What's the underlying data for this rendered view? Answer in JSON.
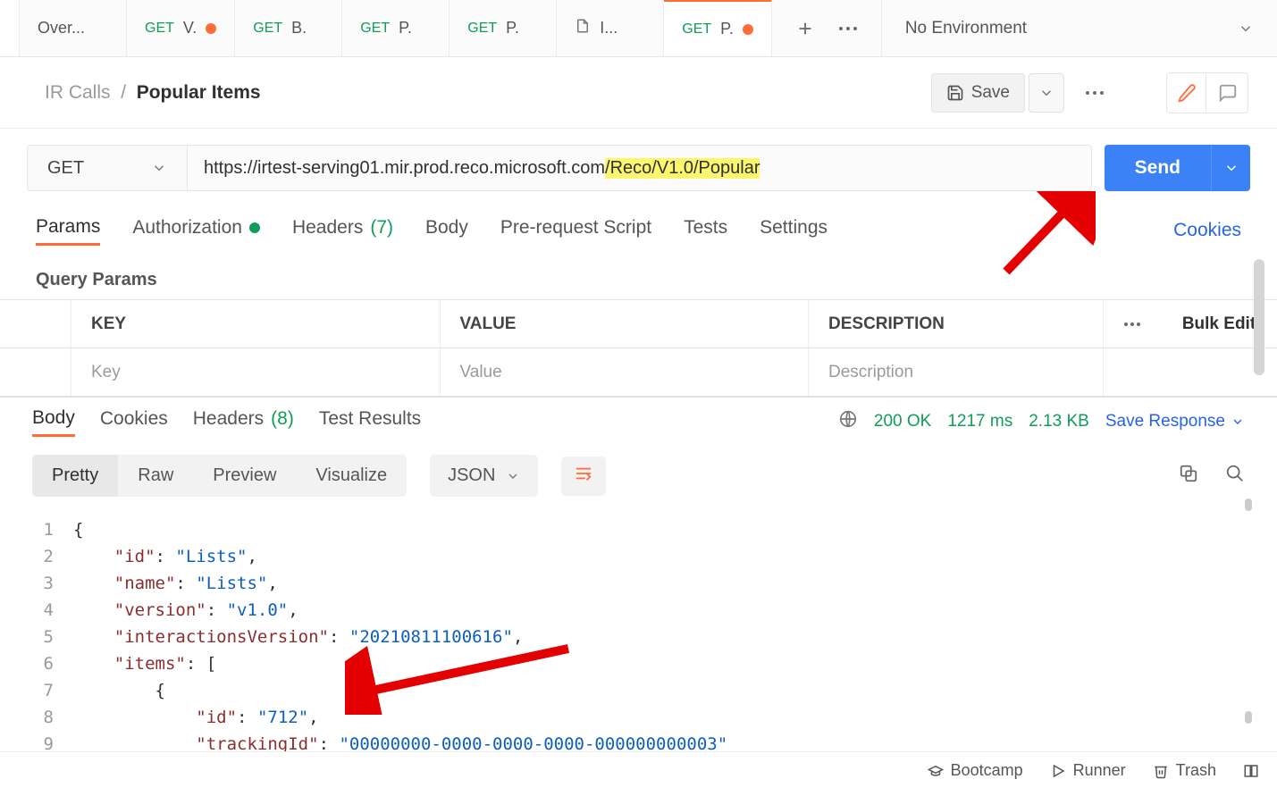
{
  "tabs": [
    {
      "label": "Over...",
      "method": ""
    },
    {
      "label": "V.",
      "method": "GET",
      "dirty": true
    },
    {
      "label": "B.",
      "method": "GET"
    },
    {
      "label": "P.",
      "method": "GET"
    },
    {
      "label": "P.",
      "method": "GET"
    },
    {
      "label": "I...",
      "method": "",
      "file": true
    },
    {
      "label": "P.",
      "method": "GET",
      "dirty": true,
      "active": true
    }
  ],
  "env": {
    "selected": "No Environment"
  },
  "breadcrumb": {
    "collection": "IR Calls",
    "current": "Popular Items"
  },
  "actions": {
    "save": "Save"
  },
  "request": {
    "method": "GET",
    "url_plain": "https://irtest-serving01.mir.prod.reco.microsoft.com",
    "url_highlight": "/Reco/V1.0/Popular",
    "send": "Send"
  },
  "reqTabs": {
    "params": "Params",
    "authorization": "Authorization",
    "headers": "Headers",
    "headers_count": "(7)",
    "body": "Body",
    "prerequest": "Pre-request Script",
    "tests": "Tests",
    "settings": "Settings",
    "cookies": "Cookies"
  },
  "queryParams": {
    "title": "Query Params",
    "headers": {
      "key": "KEY",
      "value": "VALUE",
      "description": "DESCRIPTION",
      "bulk": "Bulk Edit"
    },
    "placeholders": {
      "key": "Key",
      "value": "Value",
      "description": "Description"
    }
  },
  "response": {
    "tabs": {
      "body": "Body",
      "cookies": "Cookies",
      "headers": "Headers",
      "headers_count": "(8)",
      "testresults": "Test Results"
    },
    "status": "200 OK",
    "time": "1217 ms",
    "size": "2.13 KB",
    "saveresponse": "Save Response"
  },
  "viewRow": {
    "pretty": "Pretty",
    "raw": "Raw",
    "preview": "Preview",
    "visualize": "Visualize",
    "format": "JSON"
  },
  "json": {
    "l1": "{",
    "l2_k": "\"id\"",
    "l2_v": "\"Lists\"",
    "l3_k": "\"name\"",
    "l3_v": "\"Lists\"",
    "l4_k": "\"version\"",
    "l4_v": "\"v1.0\"",
    "l5_k": "\"interactionsVersion\"",
    "l5_v": "\"20210811100616\"",
    "l6_k": "\"items\"",
    "l7": "{",
    "l8_k": "\"id\"",
    "l8_v": "\"712\"",
    "l9_k": "\"trackingId\"",
    "l9_v": "\"00000000-0000-0000-0000-000000000003\""
  },
  "bottomBar": {
    "bootcamp": "Bootcamp",
    "runner": "Runner",
    "trash": "Trash"
  }
}
